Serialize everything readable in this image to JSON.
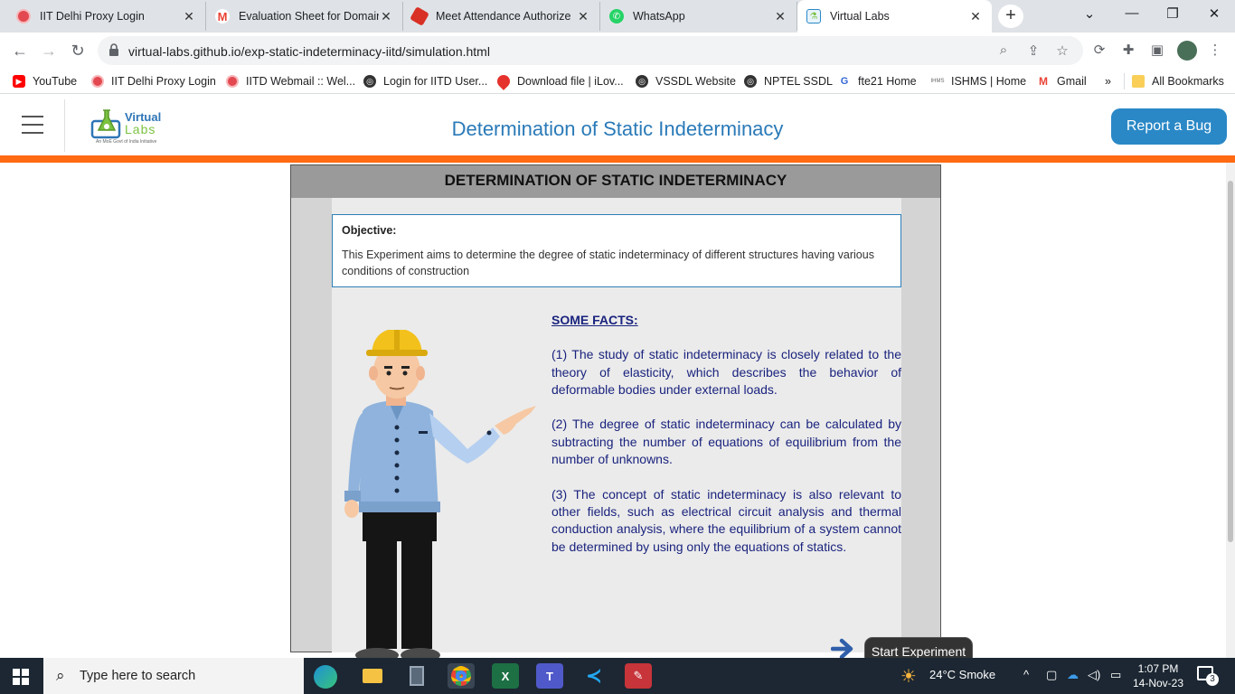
{
  "browser": {
    "tabs": [
      {
        "title": "IIT Delhi Proxy Login",
        "icon": "iitd-icon",
        "color": "#e34850"
      },
      {
        "title": "Evaluation Sheet for Domain",
        "icon": "gmail-icon",
        "color": "#ea4335"
      },
      {
        "title": "Meet Attendance Authorize",
        "icon": "apps-script-icon",
        "color": "#d93025"
      },
      {
        "title": "WhatsApp",
        "icon": "whatsapp-icon",
        "color": "#25d366"
      },
      {
        "title": "Virtual Labs",
        "icon": "virtual-labs-icon",
        "color": "#2a88c6"
      }
    ],
    "url": "virtual-labs.github.io/exp-static-indeterminacy-iitd/simulation.html",
    "bookmarks": [
      {
        "label": "YouTube",
        "color": "#ff0000"
      },
      {
        "label": "IIT Delhi Proxy Login",
        "color": "#e34850"
      },
      {
        "label": "IITD Webmail :: Wel...",
        "color": "#e34850"
      },
      {
        "label": "Login for IITD User...",
        "color": "#333333"
      },
      {
        "label": "Download file | iLov...",
        "color": "#e5322d"
      },
      {
        "label": "VSSDL Website",
        "color": "#333333"
      },
      {
        "label": "NPTEL SSDL",
        "color": "#333333"
      },
      {
        "label": "fte21 Home",
        "color": "#3367d6"
      },
      {
        "label": "ISHMS | Home",
        "color": "#666666"
      },
      {
        "label": "Gmail",
        "color": "#ea4335"
      }
    ],
    "bookmarks_overflow": "»",
    "all_bookmarks": "All Bookmarks"
  },
  "page": {
    "header_title": "Determination of Static Indeterminacy",
    "report_bug": "Report a Bug",
    "logo_line1": "Virtual",
    "logo_line2": "Labs",
    "logo_tagline": "An MoE Govt of India Initiative"
  },
  "sim": {
    "title": "DETERMINATION OF STATIC INDETERMINACY",
    "objective_heading": "Objective:",
    "objective_text": "This Experiment aims to determine the degree of static indeterminacy of different structures having various conditions of construction",
    "facts_heading": "SOME FACTS:",
    "facts": [
      "(1) The study of static indeterminacy is closely related to the theory of elasticity, which describes the behavior of deformable bodies under external loads.",
      "(2) The degree of static indeterminacy can be calculated by subtracting the number of equations of equilibrium from the number of unknowns.",
      "(3) The concept of static indeterminacy is also relevant to other fields, such as electrical circuit analysis and thermal conduction analysis, where the equilibrium of a system cannot be determined by using only the equations of statics."
    ],
    "start_button": "Start Experiment"
  },
  "taskbar": {
    "search_placeholder": "Type here to search",
    "weather": "24°C  Smoke",
    "time": "1:07 PM",
    "date": "14-Nov-23",
    "notifications": "3"
  },
  "colors": {
    "accent_orange": "#ff6a13",
    "brand_blue": "#2a88c6",
    "facts_text": "#1a237e"
  }
}
